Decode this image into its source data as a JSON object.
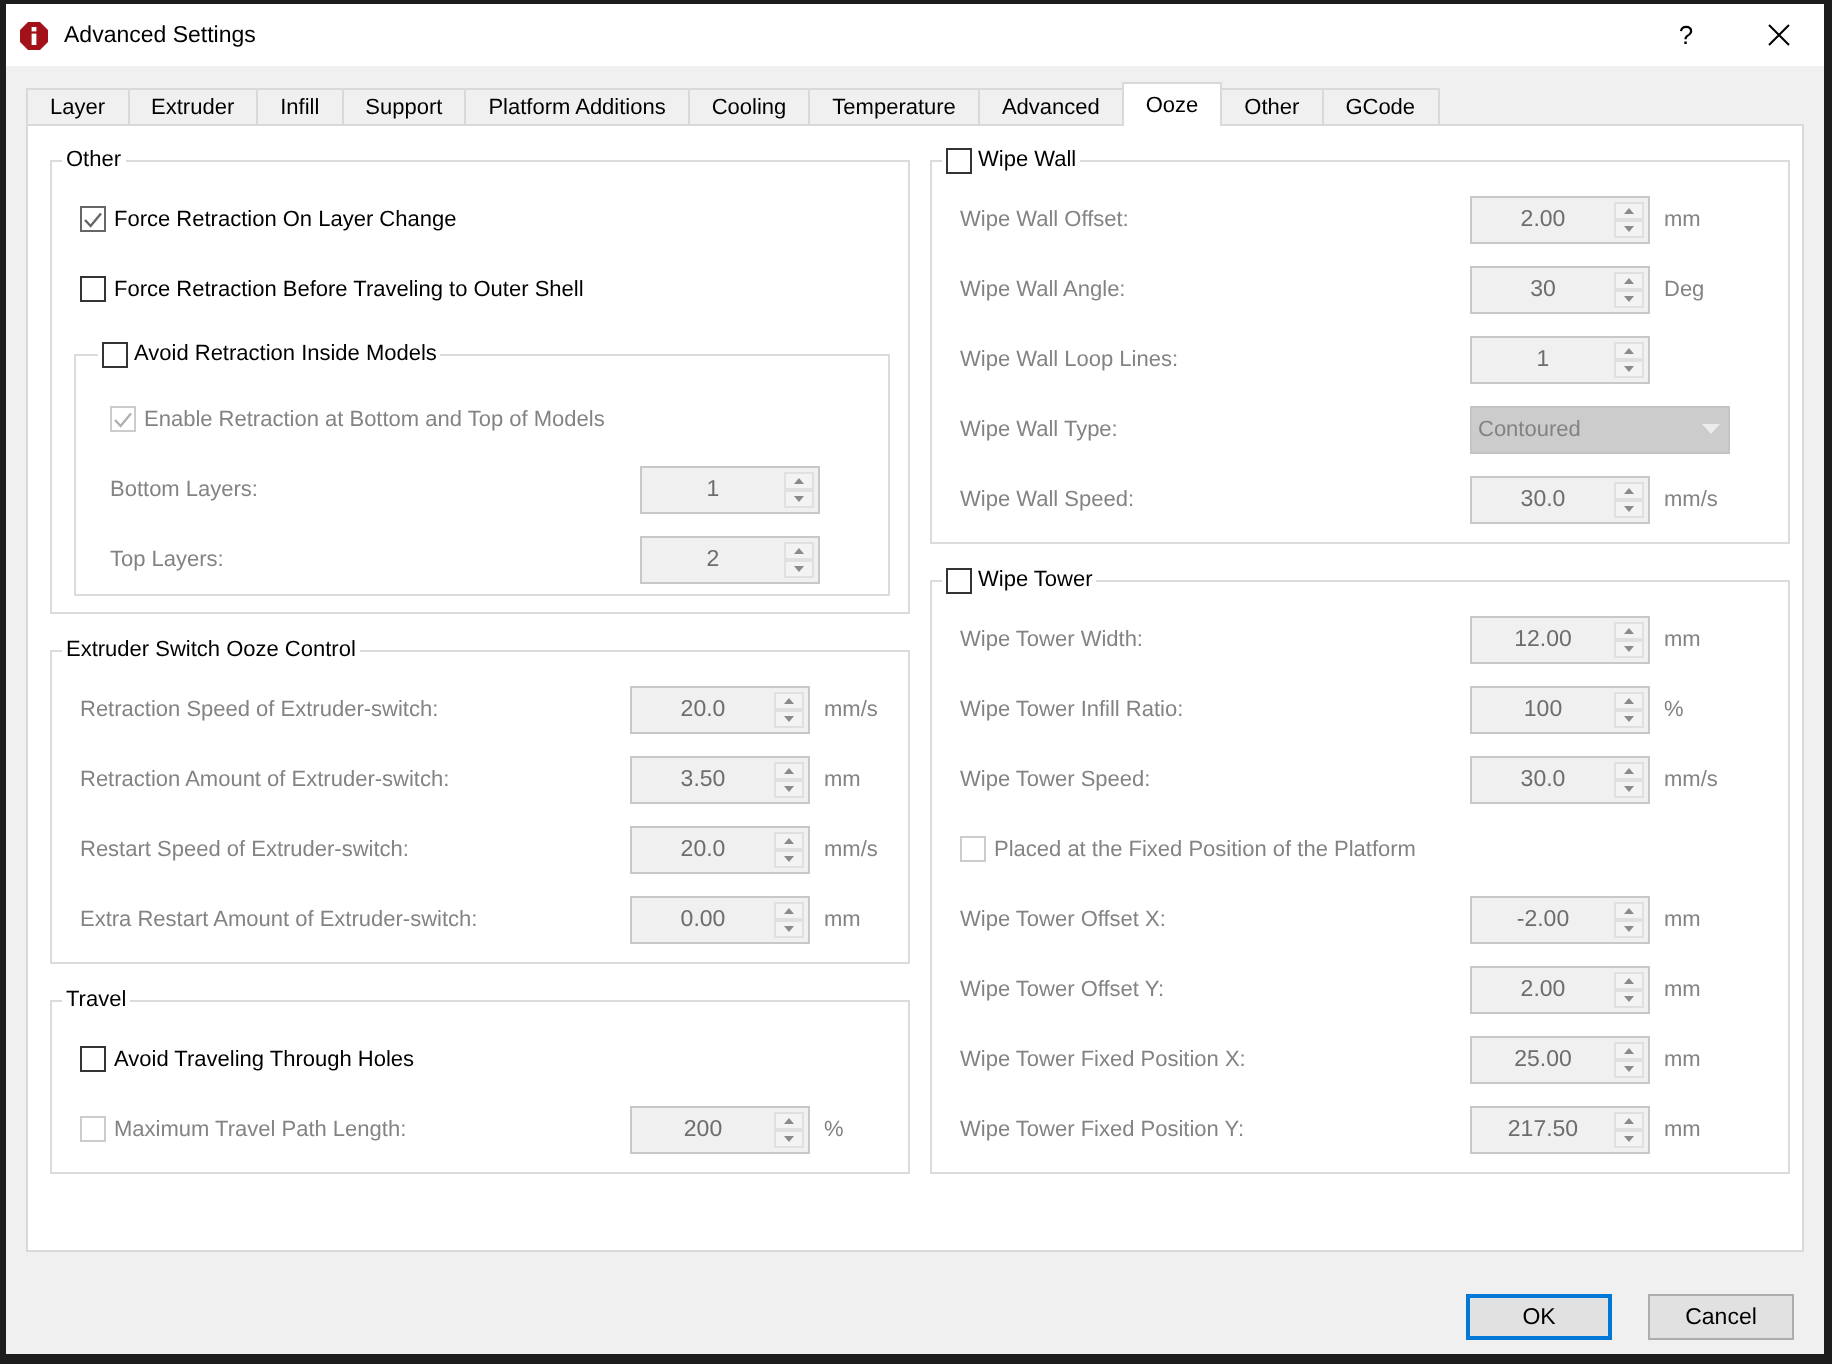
{
  "window": {
    "title": "Advanced Settings",
    "help_button": "?"
  },
  "tabs": [
    {
      "label": "Layer",
      "selected": false
    },
    {
      "label": "Extruder",
      "selected": false
    },
    {
      "label": "Infill",
      "selected": false
    },
    {
      "label": "Support",
      "selected": false
    },
    {
      "label": "Platform Additions",
      "selected": false
    },
    {
      "label": "Cooling",
      "selected": false
    },
    {
      "label": "Temperature",
      "selected": false
    },
    {
      "label": "Advanced",
      "selected": false
    },
    {
      "label": "Ooze",
      "selected": true
    },
    {
      "label": "Other",
      "selected": false
    },
    {
      "label": "GCode",
      "selected": false
    }
  ],
  "columns": [
    {
      "groups": [
        {
          "kind": "plain",
          "title": "Other",
          "items": [
            {
              "kind": "checkbox",
              "label": "Force Retraction On Layer Change",
              "checked": true,
              "disabled": false
            },
            {
              "kind": "checkbox",
              "label": "Force Retraction Before Traveling to Outer Shell",
              "checked": false,
              "disabled": false
            },
            {
              "kind": "checkable_group",
              "title": "Avoid Retraction Inside Models",
              "checked": false,
              "items": [
                {
                  "kind": "checkbox",
                  "label": "Enable Retraction at Bottom and Top of Models",
                  "checked": true,
                  "disabled": true
                },
                {
                  "kind": "spin",
                  "label": "Bottom Layers:",
                  "value": "1",
                  "disabled": true
                },
                {
                  "kind": "spin",
                  "label": "Top Layers:",
                  "value": "2",
                  "disabled": true
                }
              ]
            }
          ]
        },
        {
          "kind": "plain",
          "title": "Extruder Switch Ooze Control",
          "items": [
            {
              "kind": "spin",
              "label": "Retraction Speed of Extruder-switch:",
              "value": "20.0",
              "unit": "mm/s",
              "disabled": true
            },
            {
              "kind": "spin",
              "label": "Retraction Amount of Extruder-switch:",
              "value": "3.50",
              "unit": "mm",
              "disabled": true
            },
            {
              "kind": "spin",
              "label": "Restart Speed of Extruder-switch:",
              "value": "20.0",
              "unit": "mm/s",
              "disabled": true
            },
            {
              "kind": "spin",
              "label": "Extra Restart Amount of Extruder-switch:",
              "value": "0.00",
              "unit": "mm",
              "disabled": true
            }
          ]
        },
        {
          "kind": "plain",
          "title": "Travel",
          "items": [
            {
              "kind": "checkbox",
              "label": "Avoid Traveling Through Holes",
              "checked": false,
              "disabled": false
            },
            {
              "kind": "check_spin",
              "label": "Maximum Travel Path Length:",
              "checked": false,
              "value": "200",
              "unit": "%",
              "disabled": true
            }
          ]
        }
      ]
    },
    {
      "groups": [
        {
          "kind": "checkable",
          "title": "Wipe Wall",
          "checked": false,
          "items": [
            {
              "kind": "spin",
              "label": "Wipe Wall Offset:",
              "value": "2.00",
              "unit": "mm",
              "disabled": true
            },
            {
              "kind": "spin",
              "label": "Wipe Wall Angle:",
              "value": "30",
              "unit": "Deg",
              "disabled": true
            },
            {
              "kind": "spin",
              "label": "Wipe Wall Loop Lines:",
              "value": "1",
              "disabled": true
            },
            {
              "kind": "combo",
              "label": "Wipe Wall Type:",
              "value": "Contoured",
              "disabled": true
            },
            {
              "kind": "spin",
              "label": "Wipe Wall Speed:",
              "value": "30.0",
              "unit": "mm/s",
              "disabled": true
            }
          ]
        },
        {
          "kind": "checkable",
          "title": "Wipe Tower",
          "checked": false,
          "items": [
            {
              "kind": "spin",
              "label": "Wipe Tower Width:",
              "value": "12.00",
              "unit": "mm",
              "disabled": true
            },
            {
              "kind": "spin",
              "label": "Wipe Tower Infill Ratio:",
              "value": "100",
              "unit": "%",
              "disabled": true
            },
            {
              "kind": "spin",
              "label": "Wipe Tower Speed:",
              "value": "30.0",
              "unit": "mm/s",
              "disabled": true
            },
            {
              "kind": "checkbox",
              "label": "Placed at the Fixed Position of the Platform",
              "checked": false,
              "disabled": true
            },
            {
              "kind": "spin",
              "label": "Wipe Tower Offset X:",
              "value": "-2.00",
              "unit": "mm",
              "disabled": true
            },
            {
              "kind": "spin",
              "label": "Wipe Tower Offset Y:",
              "value": "2.00",
              "unit": "mm",
              "disabled": true
            },
            {
              "kind": "spin",
              "label": "Wipe Tower Fixed Position X:",
              "value": "25.00",
              "unit": "mm",
              "disabled": true
            },
            {
              "kind": "spin",
              "label": "Wipe Tower Fixed Position Y:",
              "value": "217.50",
              "unit": "mm",
              "disabled": true
            }
          ]
        }
      ]
    }
  ],
  "buttons": [
    {
      "label": "OK",
      "default": true
    },
    {
      "label": "Cancel",
      "default": false
    }
  ]
}
